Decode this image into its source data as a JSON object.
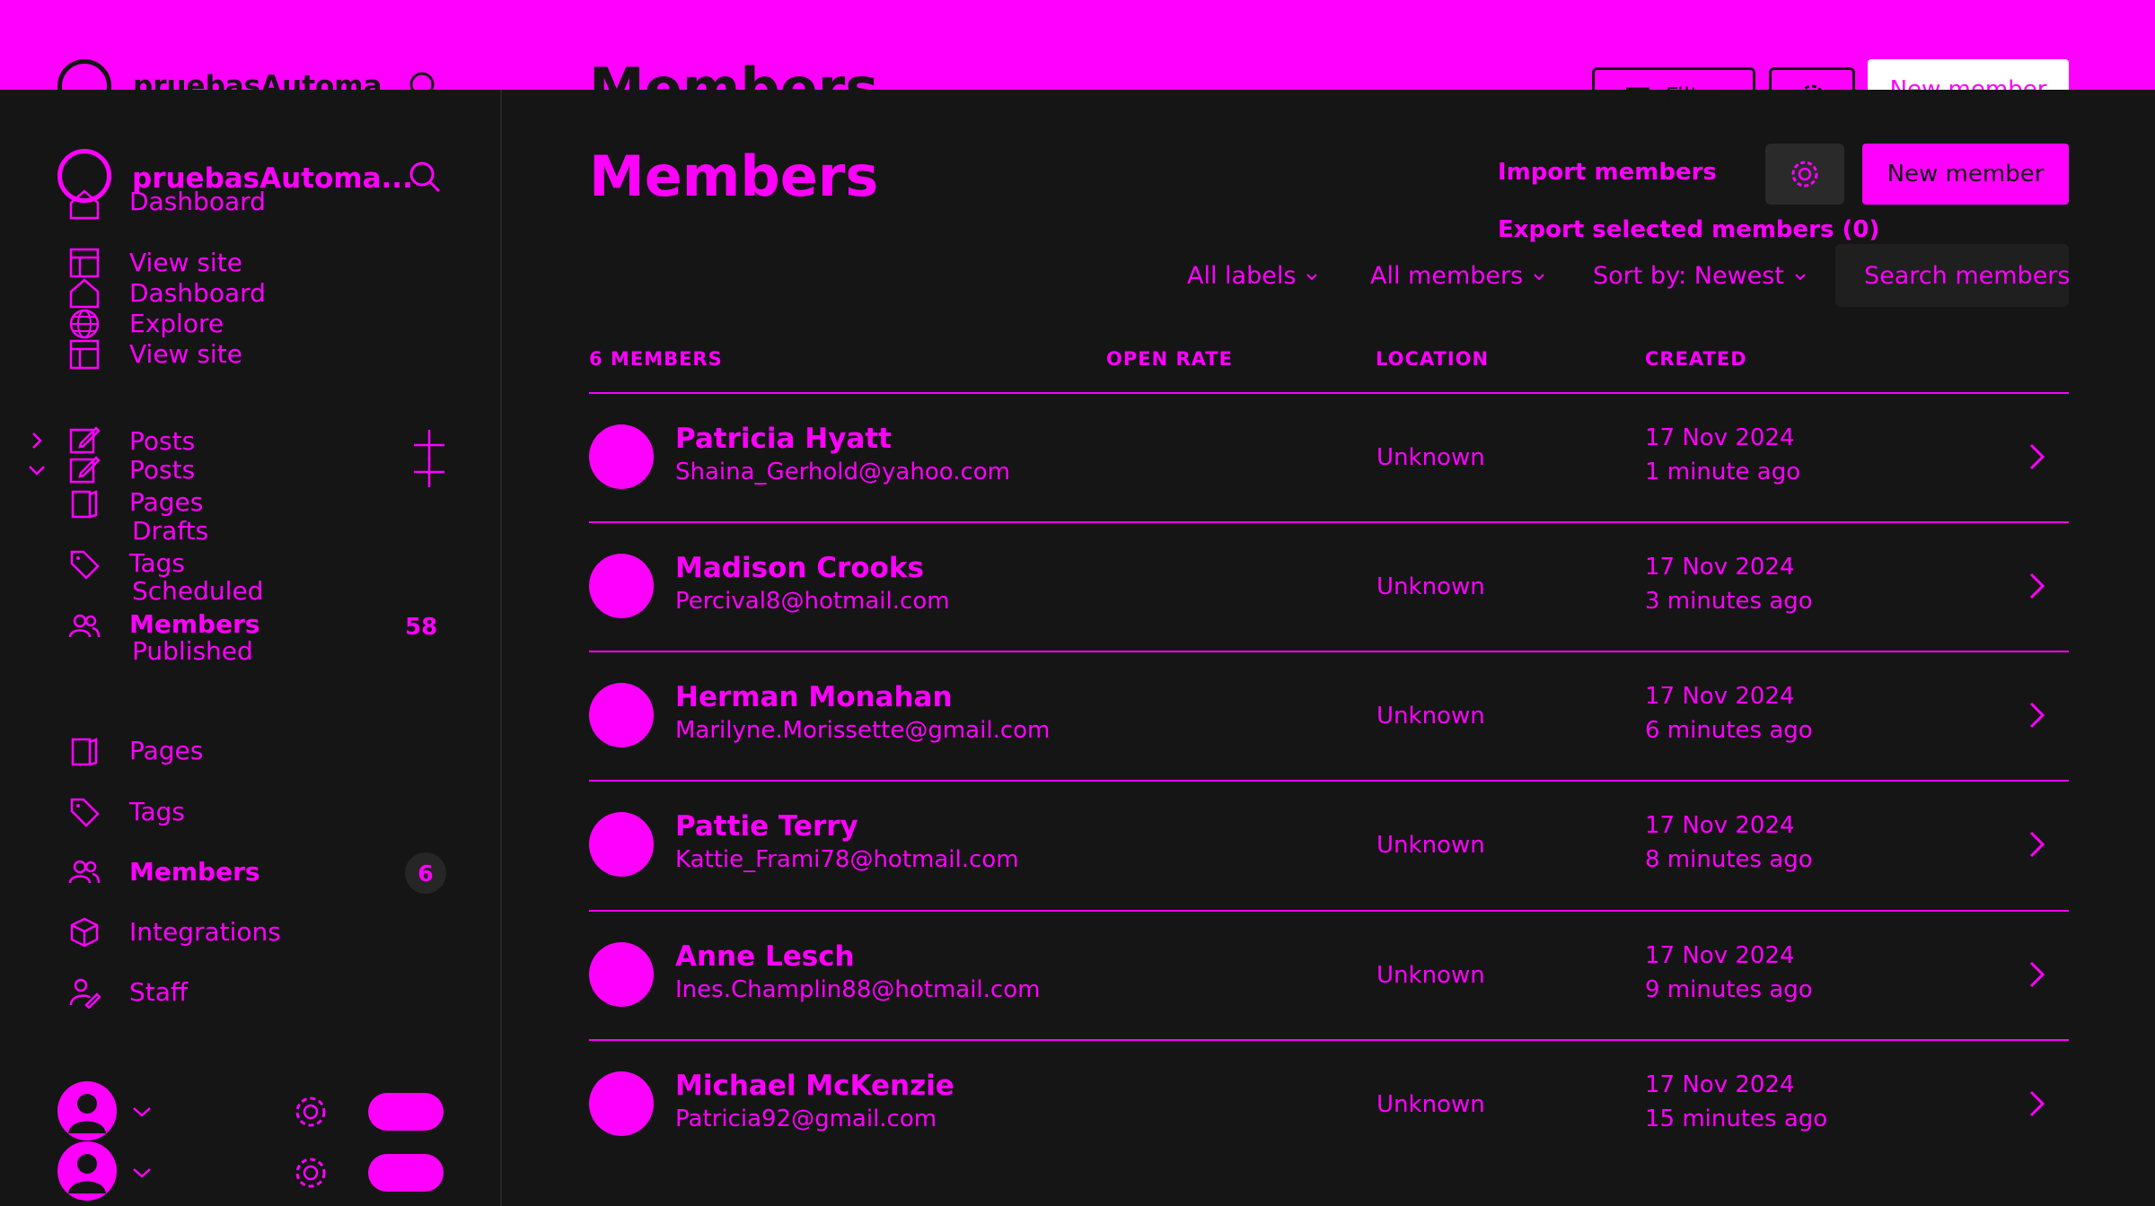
{
  "colors": {
    "accent": "#ff00ff",
    "background": "#151515",
    "panel": "#1f1f1f"
  },
  "site": {
    "name": "pruebasAutoma...",
    "name_overlap": "pruebasAutoma..."
  },
  "sidebar": {
    "ghost_items": [
      "Dashboard",
      "View site",
      "Dashboard",
      "Explore",
      "View site"
    ],
    "posts_group": {
      "label": "Posts",
      "label2": "Posts",
      "pages": "Pages",
      "drafts": "Drafts",
      "tags": "Tags",
      "scheduled": "Scheduled",
      "members": "Members",
      "members_count": "58",
      "published": "Published"
    },
    "items": [
      {
        "label": "Pages",
        "icon": "pages-icon"
      },
      {
        "label": "Tags",
        "icon": "tag-icon"
      },
      {
        "label": "Members",
        "icon": "members-icon",
        "count": "6"
      },
      {
        "label": "Integrations",
        "icon": "integrations-icon"
      },
      {
        "label": "Staff",
        "icon": "staff-icon"
      }
    ]
  },
  "header": {
    "title": "Members",
    "title_ghost": "Members",
    "filter_label": "Filter",
    "new_member_label": "New member",
    "new_member_ghost": "New member",
    "import_label": "Import members",
    "export_label": "Export selected members (0)"
  },
  "filters": {
    "labels": "All labels",
    "members": "All members",
    "sort": "Sort by: Newest",
    "search_placeholder": "Search members..."
  },
  "table": {
    "headers": [
      "6 MEMBERS",
      "OPEN RATE",
      "LOCATION",
      "CREATED"
    ],
    "rows": [
      {
        "name": "Patricia Hyatt",
        "email": "Shaina_Gerhold@yahoo.com",
        "location": "Unknown",
        "date": "17 Nov 2024",
        "ago": "1 minute ago"
      },
      {
        "name": "Madison Crooks",
        "email": "Percival8@hotmail.com",
        "location": "Unknown",
        "date": "17 Nov 2024",
        "ago": "3 minutes ago"
      },
      {
        "name": "Herman Monahan",
        "email": "Marilyne.Morissette@gmail.com",
        "location": "Unknown",
        "date": "17 Nov 2024",
        "ago": "6 minutes ago"
      },
      {
        "name": "Pattie Terry",
        "email": "Kattie_Frami78@hotmail.com",
        "location": "Unknown",
        "date": "17 Nov 2024",
        "ago": "8 minutes ago"
      },
      {
        "name": "Anne Lesch",
        "email": "Ines.Champlin88@hotmail.com",
        "location": "Unknown",
        "date": "17 Nov 2024",
        "ago": "9 minutes ago"
      },
      {
        "name": "Michael McKenzie",
        "email": "Patricia92@gmail.com",
        "location": "Unknown",
        "date": "17 Nov 2024",
        "ago": "15 minutes ago"
      }
    ]
  }
}
